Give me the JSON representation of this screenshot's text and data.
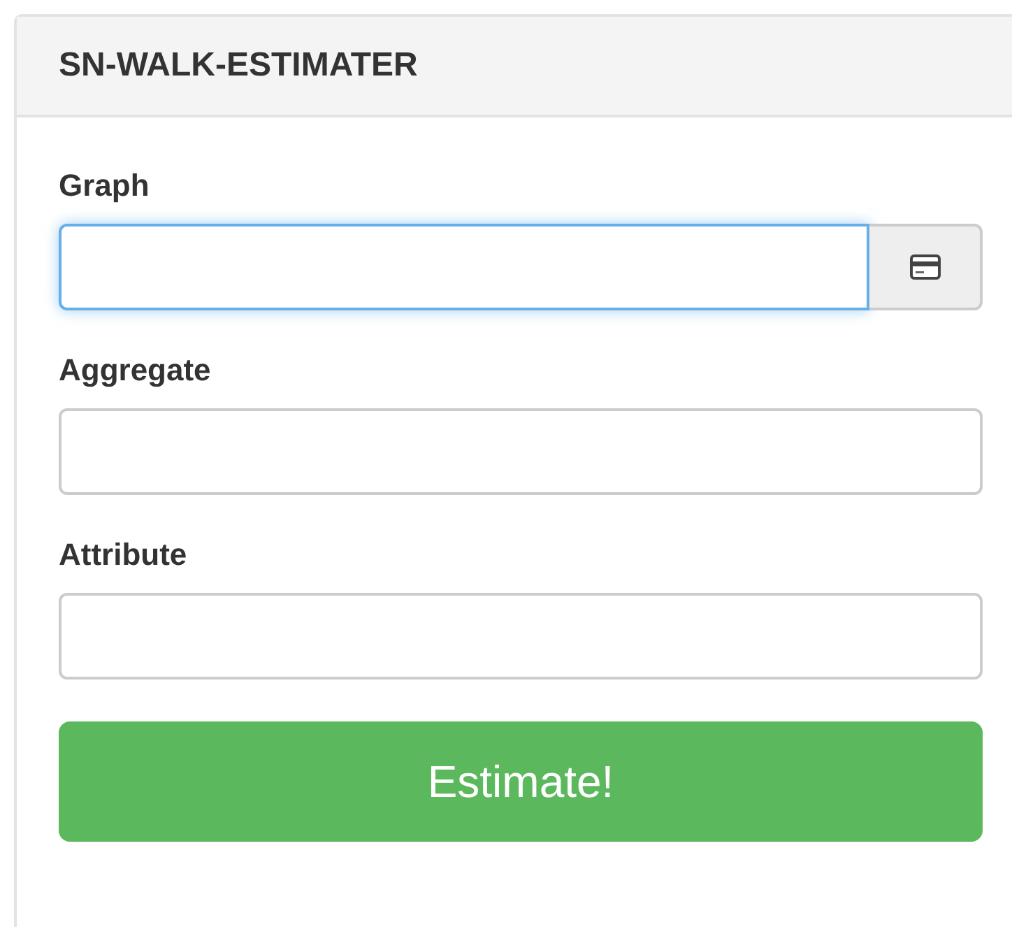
{
  "panel": {
    "title": "SN-WALK-ESTIMATER"
  },
  "fields": [
    {
      "label": "Graph",
      "focused": true,
      "addon": true
    },
    {
      "label": "Aggregate",
      "focused": false,
      "addon": false
    },
    {
      "label": "Attribute",
      "focused": false,
      "addon": false
    }
  ],
  "button": {
    "label": "Estimate!"
  }
}
